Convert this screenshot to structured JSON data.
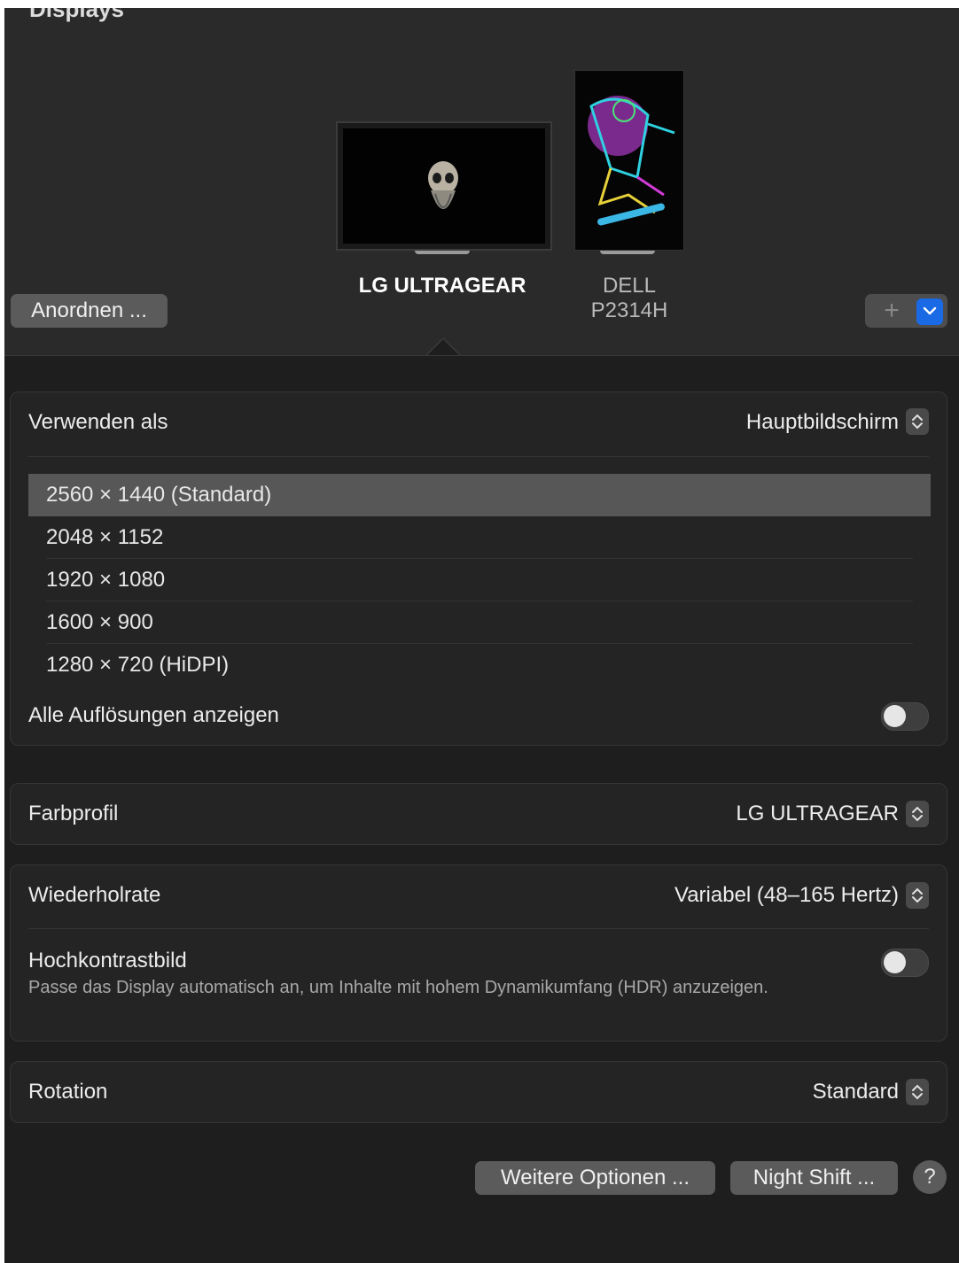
{
  "header": {
    "title": "Displays"
  },
  "displays": [
    {
      "name": "LG ULTRAGEAR",
      "selected": true
    },
    {
      "name": "DELL\nP2314H",
      "selected": false
    }
  ],
  "toolbar": {
    "arrange_label": "Anordnen ...",
    "add_symbol": "+"
  },
  "use_as": {
    "label": "Verwenden als",
    "value": "Hauptbildschirm"
  },
  "resolutions": {
    "items": [
      {
        "label": "2560 × 1440 (Standard)",
        "selected": true
      },
      {
        "label": "2048 × 1152",
        "selected": false
      },
      {
        "label": "1920 × 1080",
        "selected": false
      },
      {
        "label": "1600 × 900",
        "selected": false
      },
      {
        "label": "1280 × 720 (HiDPI)",
        "selected": false
      }
    ],
    "show_all_label": "Alle Auflösungen anzeigen",
    "show_all_on": false
  },
  "color_profile": {
    "label": "Farbprofil",
    "value": "LG ULTRAGEAR"
  },
  "refresh_rate": {
    "label": "Wiederholrate",
    "value": "Variabel (48–165 Hertz)"
  },
  "hdr": {
    "label": "Hochkontrastbild",
    "description": "Passe das Display automatisch an, um Inhalte mit hohem Dynamikumfang (HDR) anzuzeigen.",
    "on": false
  },
  "rotation": {
    "label": "Rotation",
    "value": "Standard"
  },
  "footer": {
    "more_options_label": "Weitere Optionen ...",
    "night_shift_label": "Night Shift ...",
    "help_label": "?"
  },
  "colors": {
    "accent": "#1a6ae6",
    "background": "#1e1e1e",
    "panel": "#242424"
  }
}
